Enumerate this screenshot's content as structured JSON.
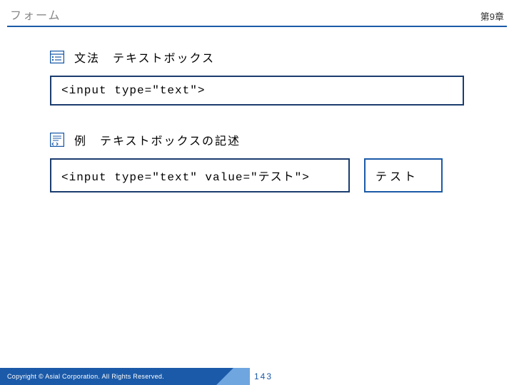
{
  "header": {
    "title": "フォーム",
    "chapter": "第9章"
  },
  "section_syntax": {
    "label": "文法　テキストボックス",
    "code": "<input type=\"text\">"
  },
  "section_example": {
    "label": "例　テキストボックスの記述",
    "code": "<input type=\"text\" value=\"テスト\">",
    "rendered_value": "テスト"
  },
  "footer": {
    "copyright": "Copyright ©  Asial Corporation. All Rights Reserved.",
    "page_number": "143"
  },
  "colors": {
    "accent": "#1b5aa8",
    "border_dark": "#1b3c6e"
  }
}
